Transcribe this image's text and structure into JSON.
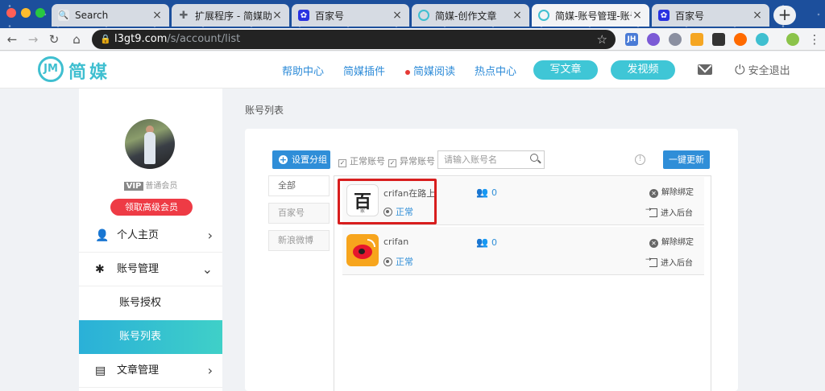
{
  "browser": {
    "tabs": [
      {
        "title": "Search",
        "icon": "search-icon",
        "icon_color": "#5f6368"
      },
      {
        "title": "扩展程序 - 简媒助手",
        "icon": "puzzle-icon",
        "icon_color": "#5f6368"
      },
      {
        "title": "百家号",
        "icon": "paw-icon",
        "icon_color": "#2932e1"
      },
      {
        "title": "简媒-创作文章",
        "icon": "jianmei-icon",
        "icon_color": "#3fbfd0"
      },
      {
        "title": "简媒-账号管理-账号",
        "icon": "jianmei-icon",
        "icon_color": "#3fbfd0"
      },
      {
        "title": "百家号",
        "icon": "paw-icon",
        "icon_color": "#2932e1"
      }
    ],
    "new_tab_label": "+",
    "url_host": "l3gt9.com",
    "url_path": "/s/account/list"
  },
  "header": {
    "logo_mark": "JM",
    "logo_text": "简媒",
    "nav": [
      "帮助中心",
      "简媒插件",
      "简媒阅读",
      "热点中心"
    ],
    "write_article": "写文章",
    "post_video": "发视频",
    "logout": "安全退出"
  },
  "sidebar": {
    "vip_badge": "VIP",
    "member_level": "普通会员",
    "upgrade": "领取高级会员",
    "items": [
      {
        "label": "个人主页",
        "icon": "user-icon"
      },
      {
        "label": "账号管理",
        "icon": "gear-icon"
      },
      {
        "label": "账号授权"
      },
      {
        "label": "账号列表"
      },
      {
        "label": "文章管理",
        "icon": "document-icon"
      }
    ]
  },
  "main": {
    "title": "账号列表",
    "group_btn": "设置分组",
    "normal_label": "正常账号",
    "abnormal_label": "异常账号",
    "search_placeholder": "请输入账号名",
    "refresh_btn": "一键更新",
    "filters": [
      "全部",
      "百家号",
      "新浪微博"
    ],
    "accounts": [
      {
        "platform": "百家号",
        "name": "crifan在路上",
        "status": "正常",
        "fans": "0",
        "unbind": "解除绑定",
        "enter": "进入后台",
        "logo_glyph": "百",
        "logo_sub": "家"
      },
      {
        "platform": "新浪微博",
        "name": "crifan",
        "status": "正常",
        "fans": "0",
        "unbind": "解除绑定",
        "enter": "进入后台"
      }
    ]
  },
  "colors": {
    "brand": "#3fbfd0",
    "link_blue": "#2f8ed8",
    "upgrade_red": "#ee3b45",
    "highlight_red": "#d81e1e"
  }
}
